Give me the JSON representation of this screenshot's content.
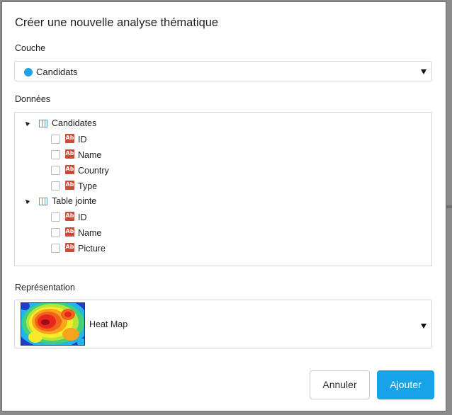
{
  "dialog": {
    "title": "Créer une nouvelle analyse thématique"
  },
  "layer": {
    "label": "Couche",
    "selected": "Candidats",
    "dot_color": "#1fa1e6",
    "caret_icon": "caret-down-icon"
  },
  "data_tree": {
    "label": "Données",
    "groups": [
      {
        "name": "Candidates",
        "icon": "table-icon",
        "fields": [
          {
            "name": "ID",
            "checked": false,
            "icon": "text-field-icon",
            "icon_text": "Ab"
          },
          {
            "name": "Name",
            "checked": false,
            "icon": "text-field-icon",
            "icon_text": "Ab"
          },
          {
            "name": "Country",
            "checked": false,
            "icon": "text-field-icon",
            "icon_text": "Ab"
          },
          {
            "name": "Type",
            "checked": false,
            "icon": "text-field-icon",
            "icon_text": "Ab"
          }
        ]
      },
      {
        "name": "Table jointe",
        "icon": "table-icon",
        "fields": [
          {
            "name": "ID",
            "checked": false,
            "icon": "text-field-icon",
            "icon_text": "Ab"
          },
          {
            "name": "Name",
            "checked": false,
            "icon": "text-field-icon",
            "icon_text": "Ab"
          },
          {
            "name": "Picture",
            "checked": false,
            "icon": "text-field-icon",
            "icon_text": "Ab"
          }
        ]
      }
    ]
  },
  "representation": {
    "label": "Représentation",
    "selected": "Heat Map",
    "preview_icon": "heatmap-preview-icon"
  },
  "buttons": {
    "cancel": "Annuler",
    "add": "Ajouter"
  },
  "colors": {
    "accent": "#17a3e8",
    "field_icon": "#cf4a36",
    "table_icon": "#3aa9e0"
  }
}
